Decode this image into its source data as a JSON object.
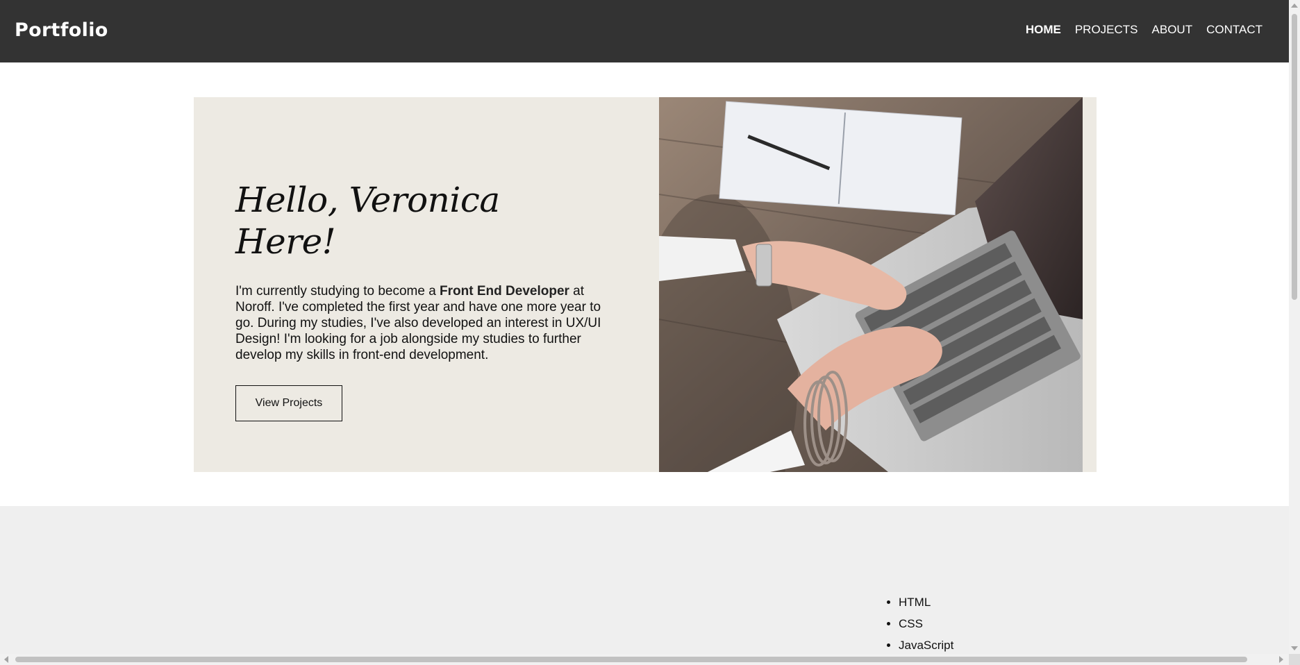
{
  "header": {
    "brand": "Portfolio",
    "nav": [
      {
        "label": "HOME",
        "active": true
      },
      {
        "label": "PROJECTS",
        "active": false
      },
      {
        "label": "ABOUT",
        "active": false
      },
      {
        "label": "CONTACT",
        "active": false
      }
    ]
  },
  "hero": {
    "title": "Hello, Veronica Here!",
    "intro_before": "I'm currently studying to become a ",
    "intro_bold": "Front End Developer",
    "intro_after": " at Noroff. I've completed the first year and have one more year to go. During my studies, I've also developed an interest in UX/UI Design! I'm looking for a job alongside my studies to further develop my skills in front-end development.",
    "button_label": "View Projects",
    "image_icon": "laptop-typing-photo"
  },
  "skills": {
    "items": [
      "HTML",
      "CSS",
      "JavaScript"
    ]
  },
  "colors": {
    "header_bg": "#333333",
    "hero_bg": "#edeae3",
    "section_bg": "#efefef"
  }
}
